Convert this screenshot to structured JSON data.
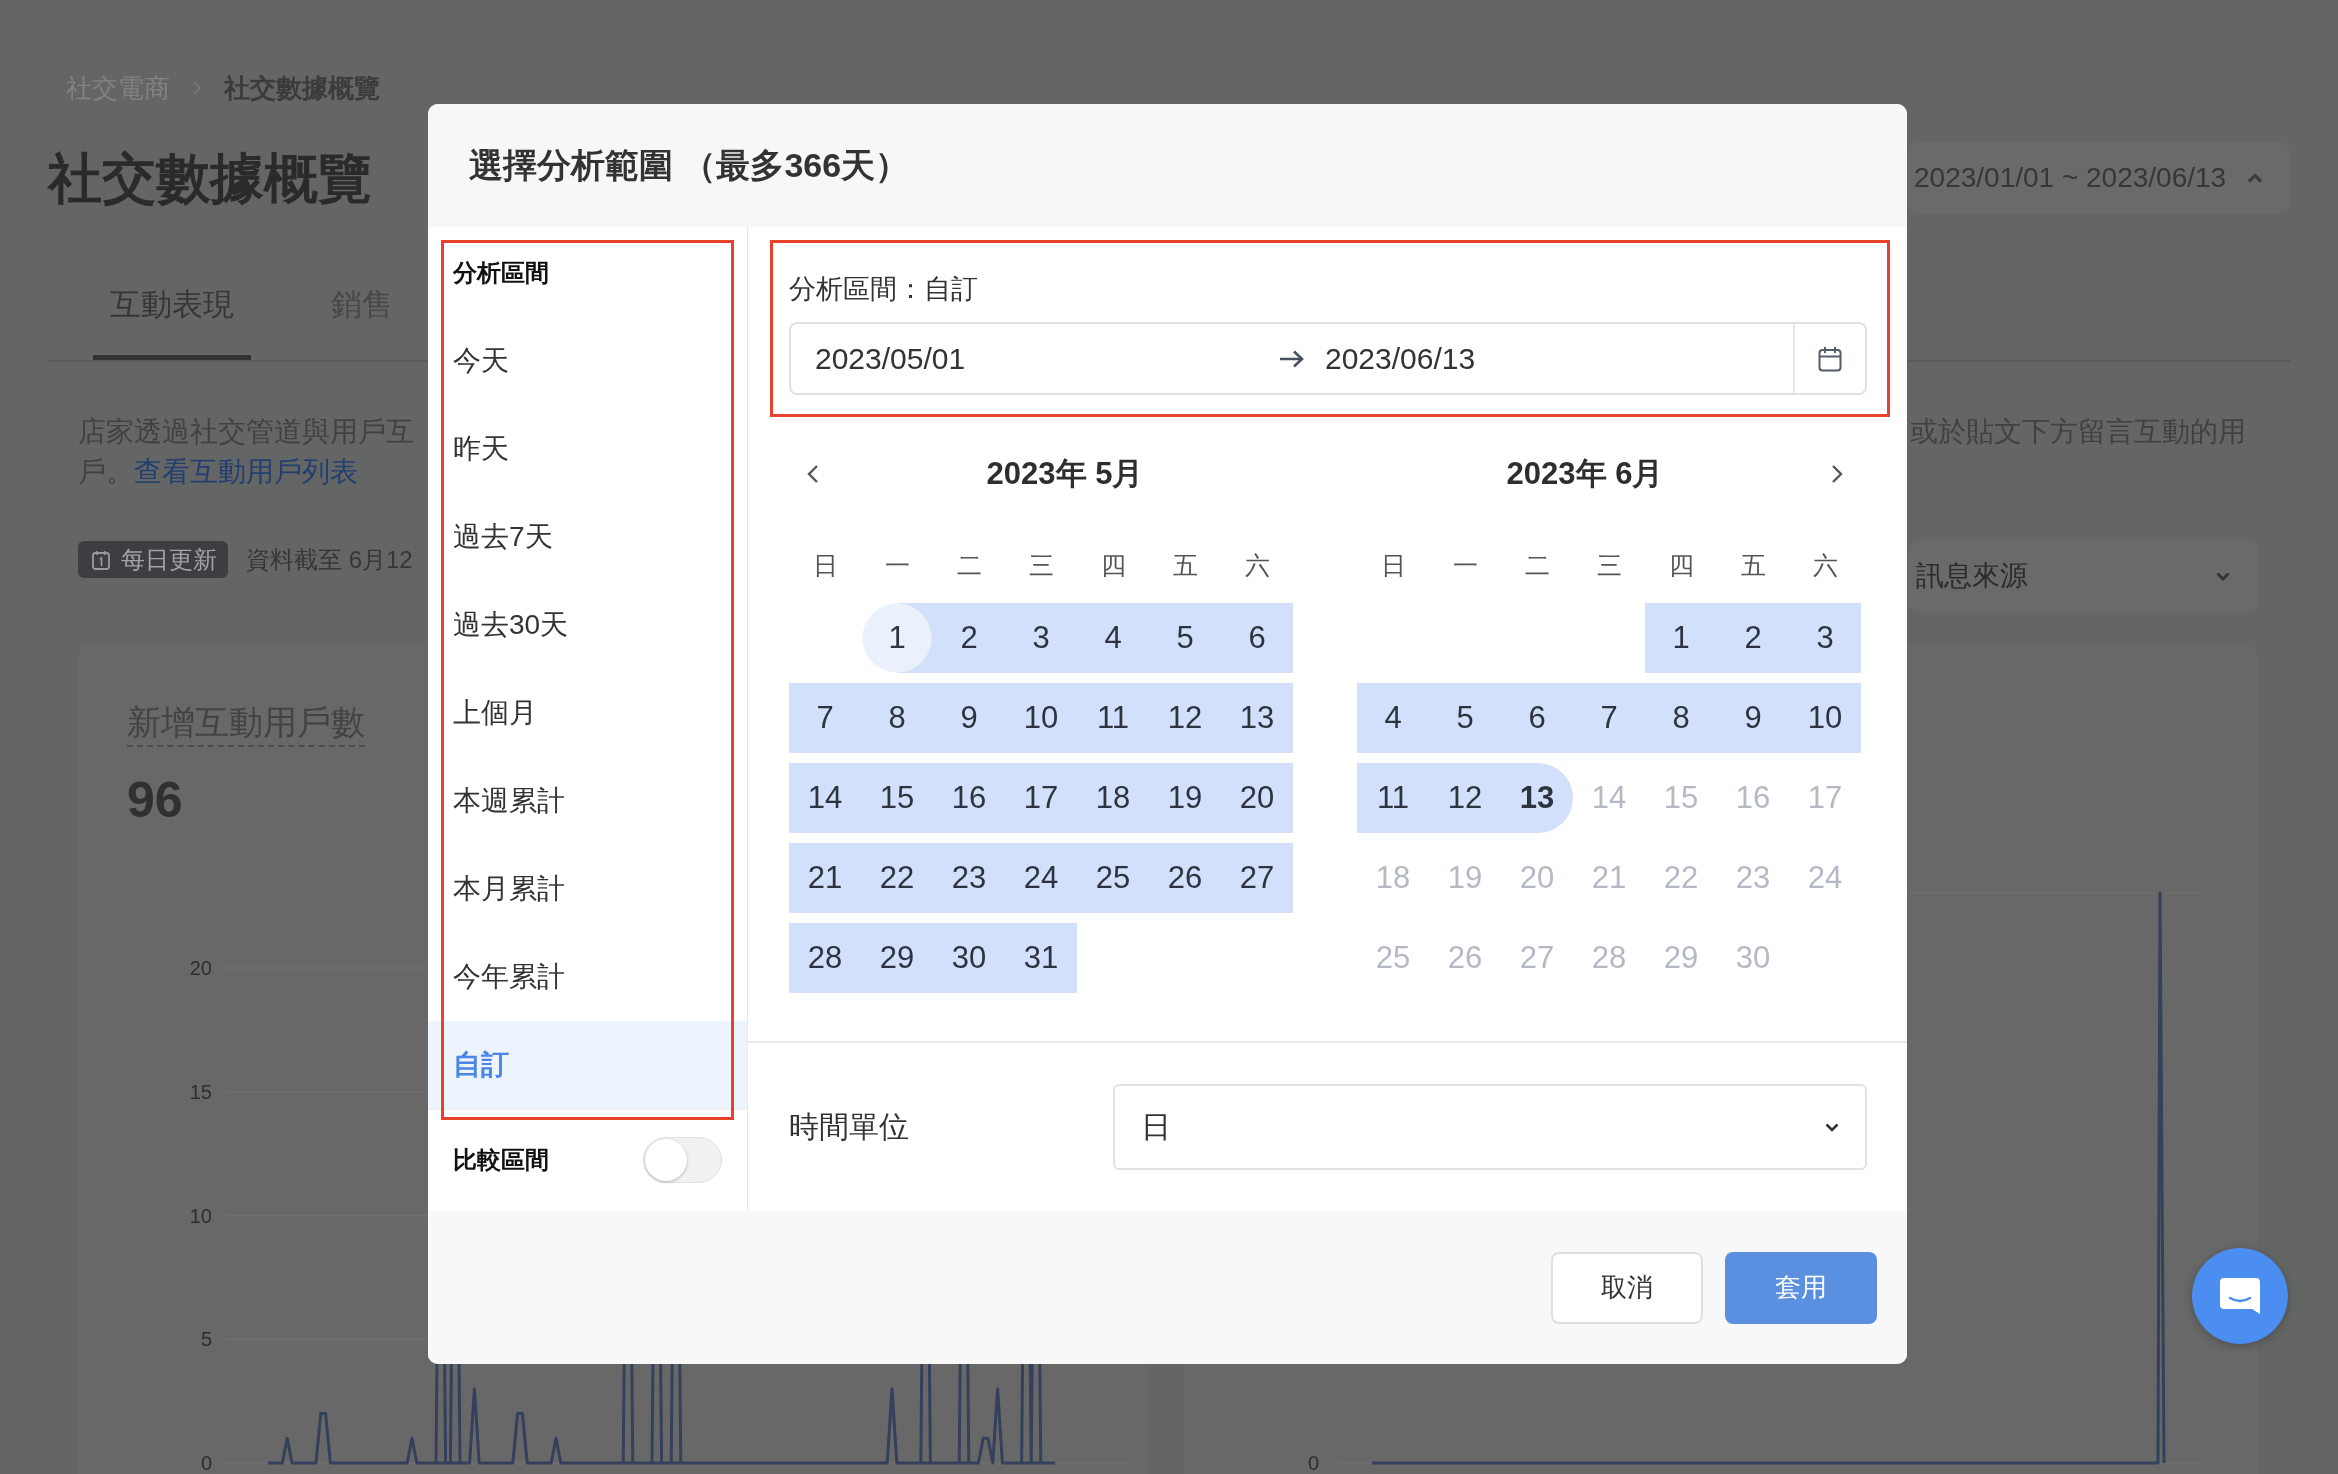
{
  "breadcrumb": [
    {
      "label": "社交電商",
      "current": false
    },
    {
      "label": "社交數據概覽",
      "current": true
    }
  ],
  "page_title": "社交數據概覽",
  "date_range_button": {
    "label": "2023/01/01 ~ 2023/06/13",
    "expanded": true
  },
  "tabs": [
    {
      "label": "互動表現",
      "selected": true
    },
    {
      "label": "銷售",
      "selected": false
    }
  ],
  "description": {
    "lines": [
      "店家透過社交管道與用戶互",
      "戶。"
    ],
    "link": "查看互動用戶列表",
    "continuation": "或於貼文下方留言互動的用"
  },
  "update_badge": {
    "label": "每日更新"
  },
  "data_note": "資料截至 6月12",
  "source_select": {
    "value": "訊息來源"
  },
  "cards": [
    {
      "title": "新增互動用戶數",
      "value": "96",
      "chart_data": [
        {
          "type": "line",
          "ylim": [
            0,
            20
          ],
          "yticks": [
            0,
            5,
            10,
            15,
            20
          ],
          "grid": true,
          "values": [
            0,
            0,
            0,
            0,
            1,
            0,
            0,
            0,
            0,
            0,
            0,
            2,
            2,
            0,
            0,
            0,
            0,
            0,
            0,
            0,
            0,
            0,
            0,
            0,
            0,
            0,
            0,
            0,
            0,
            0,
            1,
            0,
            0,
            0,
            0,
            0,
            null,
            0,
            0,
            null,
            0,
            0,
            0,
            3,
            0,
            0,
            0,
            0,
            0,
            0,
            0,
            0,
            2,
            2,
            0,
            0,
            0,
            0,
            0,
            0,
            1,
            0,
            0,
            0,
            0,
            0,
            0,
            0,
            0,
            0,
            0,
            0,
            0,
            0,
            0,
            null,
            0,
            0,
            0,
            0,
            0,
            null,
            0,
            0,
            0,
            null,
            0,
            0,
            0,
            0,
            0,
            0,
            0,
            0,
            0,
            0,
            0,
            0,
            0,
            0,
            0,
            0,
            0,
            0,
            0,
            0,
            0,
            0,
            0,
            0,
            0,
            0,
            0,
            0,
            0,
            0,
            0,
            0,
            0,
            0,
            0,
            0,
            0,
            0,
            0,
            0,
            0,
            0,
            0,
            0,
            3,
            0,
            0,
            0,
            0,
            0,
            0,
            null,
            0,
            0,
            0,
            0,
            0,
            0,
            0,
            null,
            0,
            0,
            0,
            1,
            1,
            0,
            3,
            0,
            0,
            0,
            0,
            0,
            null,
            0,
            null,
            0,
            0,
            0,
            0
          ]
        }
      ]
    },
    {
      "y_labels": [
        "0"
      ]
    }
  ],
  "dialog": {
    "title": "選擇分析範圍 （最多366天）",
    "presets": {
      "heading": "分析區間",
      "items": [
        {
          "label": "今天",
          "selected": false
        },
        {
          "label": "昨天",
          "selected": false
        },
        {
          "label": "過去7天",
          "selected": false
        },
        {
          "label": "過去30天",
          "selected": false
        },
        {
          "label": "上個月",
          "selected": false
        },
        {
          "label": "本週累計",
          "selected": false
        },
        {
          "label": "本月累計",
          "selected": false
        },
        {
          "label": "今年累計",
          "selected": false
        },
        {
          "label": "自訂",
          "selected": true
        }
      ]
    },
    "compare": {
      "label": "比較區間",
      "on": false
    },
    "range_label": "分析區間：自訂",
    "date_range": {
      "start": "2023/05/01",
      "end": "2023/06/13"
    },
    "calendars": [
      {
        "title": "2023年 5月",
        "weekdays": [
          "日",
          "一",
          "二",
          "三",
          "四",
          "五",
          "六"
        ],
        "weeks": [
          [
            {
              "label": "1",
              "in_range": true,
              "selected": true,
              "disabled": false
            },
            {
              "label": "2",
              "in_range": true,
              "selected": false,
              "disabled": false
            },
            {
              "label": "3",
              "in_range": true,
              "selected": false,
              "disabled": false
            },
            {
              "label": "4",
              "in_range": true,
              "selected": false,
              "disabled": false
            },
            {
              "label": "5",
              "in_range": true,
              "selected": false,
              "disabled": false
            },
            {
              "label": "6",
              "in_range": true,
              "selected": false,
              "disabled": false
            }
          ],
          [
            {
              "label": "7",
              "in_range": true,
              "selected": false,
              "disabled": false
            },
            {
              "label": "8",
              "in_range": true,
              "selected": false,
              "disabled": false
            },
            {
              "label": "9",
              "in_range": true,
              "selected": false,
              "disabled": false
            },
            {
              "label": "10",
              "in_range": true,
              "selected": false,
              "disabled": false
            },
            {
              "label": "11",
              "in_range": true,
              "selected": false,
              "disabled": false
            },
            {
              "label": "12",
              "in_range": true,
              "selected": false,
              "disabled": false
            },
            {
              "label": "13",
              "in_range": true,
              "selected": false,
              "disabled": false
            }
          ],
          [
            {
              "label": "14",
              "in_range": true,
              "selected": false,
              "disabled": false
            },
            {
              "label": "15",
              "in_range": true,
              "selected": false,
              "disabled": false
            },
            {
              "label": "16",
              "in_range": true,
              "selected": false,
              "disabled": false
            },
            {
              "label": "17",
              "in_range": true,
              "selected": false,
              "disabled": false
            },
            {
              "label": "18",
              "in_range": true,
              "selected": false,
              "disabled": false
            },
            {
              "label": "19",
              "in_range": true,
              "selected": false,
              "disabled": false
            },
            {
              "label": "20",
              "in_range": true,
              "selected": false,
              "disabled": false
            }
          ],
          [
            {
              "label": "21",
              "in_range": true,
              "selected": false,
              "disabled": false
            },
            {
              "label": "22",
              "in_range": true,
              "selected": false,
              "disabled": false
            },
            {
              "label": "23",
              "in_range": true,
              "selected": false,
              "disabled": false
            },
            {
              "label": "24",
              "in_range": true,
              "selected": false,
              "disabled": false
            },
            {
              "label": "25",
              "in_range": true,
              "selected": false,
              "disabled": false
            },
            {
              "label": "26",
              "in_range": true,
              "selected": false,
              "disabled": false
            },
            {
              "label": "27",
              "in_range": true,
              "selected": false,
              "disabled": false
            }
          ],
          [
            {
              "label": "28",
              "in_range": true,
              "selected": false,
              "disabled": false
            },
            {
              "label": "29",
              "in_range": true,
              "selected": false,
              "disabled": false
            },
            {
              "label": "30",
              "in_range": true,
              "selected": false,
              "disabled": false
            },
            {
              "label": "31",
              "in_range": true,
              "selected": false,
              "disabled": false
            }
          ]
        ]
      },
      {
        "title": "2023年 6月",
        "weekdays": [
          "日",
          "一",
          "二",
          "三",
          "四",
          "五",
          "六"
        ],
        "weeks": [
          [
            {
              "label": "1",
              "in_range": true,
              "selected": false,
              "disabled": false
            },
            {
              "label": "2",
              "in_range": true,
              "selected": false,
              "disabled": false
            },
            {
              "label": "3",
              "in_range": true,
              "selected": false,
              "disabled": false
            }
          ],
          [
            {
              "label": "4",
              "in_range": true,
              "selected": false,
              "disabled": false
            },
            {
              "label": "5",
              "in_range": true,
              "selected": false,
              "disabled": false
            },
            {
              "label": "6",
              "in_range": true,
              "selected": false,
              "disabled": false
            },
            {
              "label": "7",
              "in_range": true,
              "selected": false,
              "disabled": false
            },
            {
              "label": "8",
              "in_range": true,
              "selected": false,
              "disabled": false
            },
            {
              "label": "9",
              "in_range": true,
              "selected": false,
              "disabled": false
            },
            {
              "label": "10",
              "in_range": true,
              "selected": false,
              "disabled": false
            }
          ],
          [
            {
              "label": "11",
              "in_range": true,
              "selected": false,
              "disabled": false
            },
            {
              "label": "12",
              "in_range": true,
              "selected": false,
              "disabled": false
            },
            {
              "label": "13",
              "in_range": true,
              "selected": true,
              "disabled": false
            },
            {
              "label": "14",
              "in_range": false,
              "selected": false,
              "disabled": true
            },
            {
              "label": "15",
              "in_range": false,
              "selected": false,
              "disabled": true
            },
            {
              "label": "16",
              "in_range": false,
              "selected": false,
              "disabled": true
            },
            {
              "label": "17",
              "in_range": false,
              "selected": false,
              "disabled": true
            }
          ],
          [
            {
              "label": "18",
              "in_range": false,
              "selected": false,
              "disabled": true
            },
            {
              "label": "19",
              "in_range": false,
              "selected": false,
              "disabled": true
            },
            {
              "label": "20",
              "in_range": false,
              "selected": false,
              "disabled": true
            },
            {
              "label": "21",
              "in_range": false,
              "selected": false,
              "disabled": true
            },
            {
              "label": "22",
              "in_range": false,
              "selected": false,
              "disabled": true
            },
            {
              "label": "23",
              "in_range": false,
              "selected": false,
              "disabled": true
            },
            {
              "label": "24",
              "in_range": false,
              "selected": false,
              "disabled": true
            }
          ],
          [
            {
              "label": "25",
              "in_range": false,
              "selected": false,
              "disabled": true
            },
            {
              "label": "26",
              "in_range": false,
              "selected": false,
              "disabled": true
            },
            {
              "label": "27",
              "in_range": false,
              "selected": false,
              "disabled": true
            },
            {
              "label": "28",
              "in_range": false,
              "selected": false,
              "disabled": true
            },
            {
              "label": "29",
              "in_range": false,
              "selected": false,
              "disabled": true
            },
            {
              "label": "30",
              "in_range": false,
              "selected": false,
              "disabled": true
            }
          ]
        ]
      }
    ],
    "time_unit": {
      "label": "時間單位",
      "value": "日"
    },
    "buttons": [
      {
        "label": "取消",
        "kind": "secondary"
      },
      {
        "label": "套用",
        "kind": "primary"
      }
    ]
  }
}
